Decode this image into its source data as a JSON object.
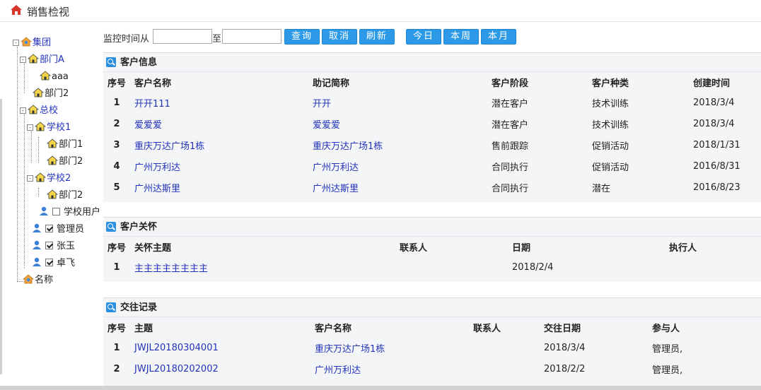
{
  "app": {
    "title": "销售检视",
    "icon": "home-icon"
  },
  "tree": {
    "nodes": [
      {
        "label": "集团",
        "icon": "org-icon",
        "expand": "-"
      },
      {
        "label": "部门A",
        "icon": "house-icon",
        "expand": "-"
      },
      {
        "label": "aaa",
        "icon": "house-icon"
      },
      {
        "label": "部门2",
        "icon": "house-icon"
      },
      {
        "label": "总校",
        "icon": "house-icon",
        "expand": "-"
      },
      {
        "label": "学校1",
        "icon": "house-icon",
        "expand": "-"
      },
      {
        "label": "部门1",
        "icon": "house-icon"
      },
      {
        "label": "部门2",
        "icon": "house-icon"
      },
      {
        "label": "学校2",
        "icon": "house-icon",
        "expand": "-"
      },
      {
        "label": "部门2",
        "icon": "house-icon"
      },
      {
        "label": "学校用户",
        "icon": "user-icon",
        "checked": false
      },
      {
        "label": "管理员",
        "icon": "user-icon",
        "checked": true
      },
      {
        "label": "张玉",
        "icon": "user-icon",
        "checked": true
      },
      {
        "label": "卓飞",
        "icon": "user-icon",
        "checked": true
      },
      {
        "label": "名称",
        "icon": "org-icon"
      }
    ]
  },
  "filter": {
    "label_from": "监控时间从",
    "label_to": "至",
    "from_value": "",
    "to_value": "",
    "buttons": {
      "query": "查询",
      "cancel": "取消",
      "refresh": "刷新",
      "today": "今日",
      "week": "本周",
      "month": "本月"
    }
  },
  "customers": {
    "title": "客户信息",
    "columns": [
      "序号",
      "客户名称",
      "助记简称",
      "客户阶段",
      "客户种类",
      "创建时间"
    ],
    "rows": [
      [
        "1",
        "开开111",
        "开开",
        "潜在客户",
        "技术训练",
        "2018/3/4"
      ],
      [
        "2",
        "爱爱爱",
        "爱爱爱",
        "潜在客户",
        "技术训练",
        "2018/3/4"
      ],
      [
        "3",
        "重庆万达广场1栋",
        "重庆万达广场1栋",
        "售前跟踪",
        "促销活动",
        "2018/1/31"
      ],
      [
        "4",
        "广州万利达",
        "广州万利达",
        "合同执行",
        "促销活动",
        "2016/8/31"
      ],
      [
        "5",
        "广州达斯里",
        "广州达斯里",
        "合同执行",
        "潜在",
        "2016/8/23"
      ]
    ]
  },
  "care": {
    "title": "客户关怀",
    "columns": [
      "序号",
      "关怀主题",
      "联系人",
      "日期",
      "执行人"
    ],
    "rows": [
      [
        "1",
        "主主主主主主主主",
        "",
        "2018/2/4",
        ""
      ]
    ]
  },
  "contacts": {
    "title": "交往记录",
    "columns": [
      "序号",
      "主题",
      "客户名称",
      "联系人",
      "交往日期",
      "参与人"
    ],
    "rows": [
      [
        "1",
        "JWJL20180304001",
        "重庆万达广场1栋",
        "",
        "2018/3/4",
        "管理员,"
      ],
      [
        "2",
        "JWJL20180202002",
        "广州万利达",
        "",
        "2018/2/2",
        "管理员,"
      ]
    ]
  }
}
